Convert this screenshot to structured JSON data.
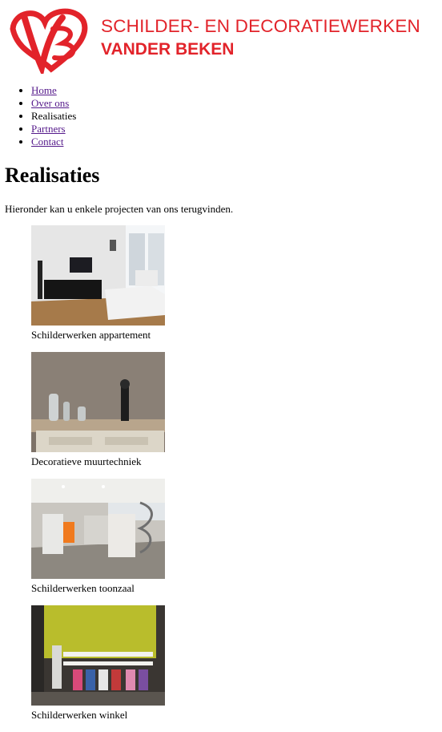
{
  "header": {
    "logo_line1": "SCHILDER- EN DECORATIEWERKEN",
    "logo_line2": "VANDER BEKEN",
    "brand_color": "#e2232a"
  },
  "nav": {
    "items": [
      {
        "label": "Home",
        "link": true
      },
      {
        "label": "Over ons",
        "link": true
      },
      {
        "label": "Realisaties",
        "link": false
      },
      {
        "label": "Partners",
        "link": true
      },
      {
        "label": "Contact",
        "link": true
      }
    ]
  },
  "main": {
    "title": "Realisaties",
    "intro": "Hieronder kan u enkele projecten van ons terugvinden.",
    "projects": [
      {
        "caption": "Schilderwerken appartement",
        "image": "living-room-photo"
      },
      {
        "caption": "Decoratieve muurtechniek",
        "image": "decorative-wall-photo"
      },
      {
        "caption": "Schilderwerken toonzaal",
        "image": "showroom-photo"
      },
      {
        "caption": "Schilderwerken winkel",
        "image": "shop-photo"
      }
    ]
  }
}
